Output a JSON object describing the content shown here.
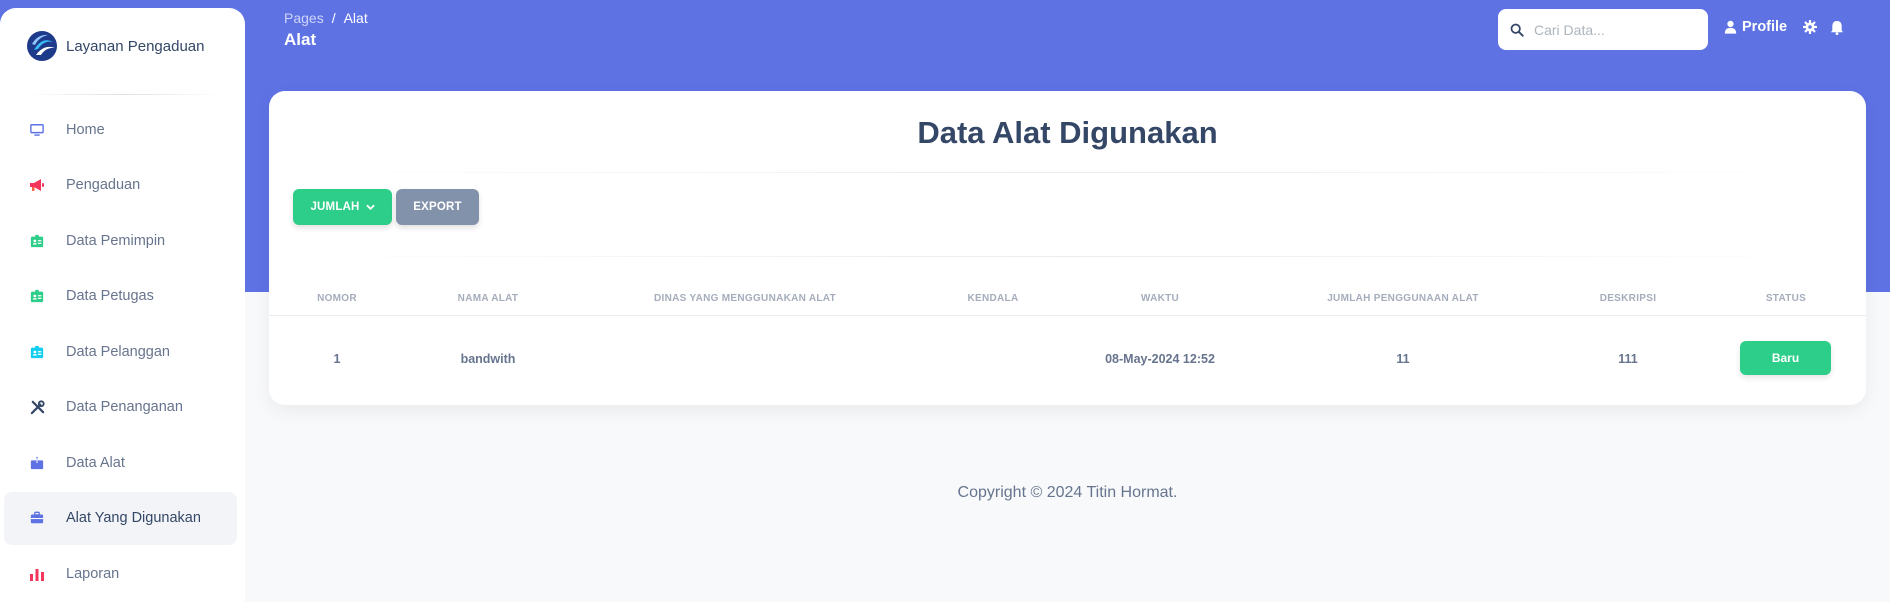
{
  "sidebar": {
    "brand": "Layanan Pengaduan",
    "items": [
      {
        "label": "Home",
        "icon": "monitor-icon",
        "color": "#5e72e4"
      },
      {
        "label": "Pengaduan",
        "icon": "megaphone-icon",
        "color": "#f5365c"
      },
      {
        "label": "Data Pemimpin",
        "icon": "id-card-icon",
        "color": "#2dce89"
      },
      {
        "label": "Data Petugas",
        "icon": "id-card-icon",
        "color": "#2dce89"
      },
      {
        "label": "Data Pelanggan",
        "icon": "id-card-icon",
        "color": "#11cdef"
      },
      {
        "label": "Data Penanganan",
        "icon": "tools-icon",
        "color": "#344767"
      },
      {
        "label": "Data Alat",
        "icon": "box-icon",
        "color": "#5e72e4"
      },
      {
        "label": "Alat Yang Digunakan",
        "icon": "briefcase-icon",
        "color": "#5e72e4",
        "active": true
      },
      {
        "label": "Laporan",
        "icon": "bar-chart-icon",
        "color": "#f5365c"
      }
    ]
  },
  "header": {
    "breadcrumb_root": "Pages",
    "breadcrumb_separator": "/",
    "breadcrumb_current": "Alat",
    "title": "Alat"
  },
  "search": {
    "placeholder": "Cari Data..."
  },
  "actions": {
    "profile_label": "Profile"
  },
  "card": {
    "title": "Data Alat Digunakan",
    "jumlah_label": "JUMLAH",
    "export_label": "EXPORT"
  },
  "table": {
    "headers": [
      "NOMOR",
      "NAMA ALAT",
      "DINAS YANG MENGGUNAKAN ALAT",
      "KENDALA",
      "WAKTU",
      "JUMLAH PENGGUNAAN ALAT",
      "DESKRIPSI",
      "STATUS"
    ],
    "rows": [
      {
        "nomor": "1",
        "nama_alat": "bandwith",
        "dinas": "",
        "kendala": "",
        "waktu": "08-May-2024 12:52",
        "jumlah": "11",
        "deskripsi": "111",
        "status": "Baru"
      }
    ]
  },
  "footer": {
    "copyright": "Copyright © 2024 Titin Hormat."
  },
  "colors": {
    "primary": "#5e72e4",
    "success": "#2dce89",
    "secondary": "#8392ab",
    "text": "#344767"
  }
}
